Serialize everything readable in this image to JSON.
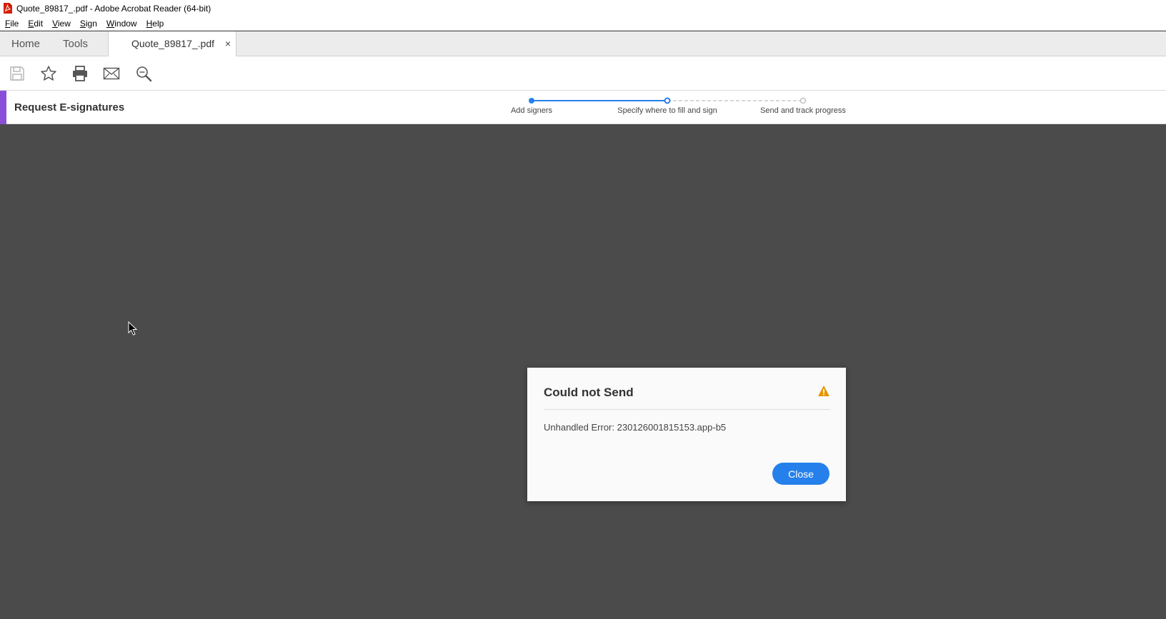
{
  "window": {
    "title": "Quote_89817_.pdf - Adobe Acrobat Reader (64-bit)",
    "app_icon": "acrobat-pdf-icon"
  },
  "menubar": {
    "items": [
      {
        "label": "File"
      },
      {
        "label": "Edit"
      },
      {
        "label": "View"
      },
      {
        "label": "Sign"
      },
      {
        "label": "Window"
      },
      {
        "label": "Help"
      }
    ]
  },
  "tabs": {
    "home": "Home",
    "tools": "Tools",
    "document": "Quote_89817_.pdf",
    "close_glyph": "×"
  },
  "toolbar": {
    "icons": [
      "save-icon",
      "star-icon",
      "print-icon",
      "email-icon",
      "search-zoom-icon"
    ]
  },
  "esign": {
    "title": "Request E-signatures",
    "steps": [
      {
        "label": "Add signers",
        "state": "complete"
      },
      {
        "label": "Specify where to fill and sign",
        "state": "current"
      },
      {
        "label": "Send and track progress",
        "state": "pending"
      }
    ],
    "accent_color": "#8a4fd8",
    "progress_color": "#2680eb"
  },
  "dialog": {
    "title": "Could not Send",
    "message": "Unhandled Error: 230126001815153.app-b5",
    "close_label": "Close",
    "icon": "warning-icon",
    "button_color": "#2680eb"
  },
  "workspace_color": "#4b4b4b"
}
